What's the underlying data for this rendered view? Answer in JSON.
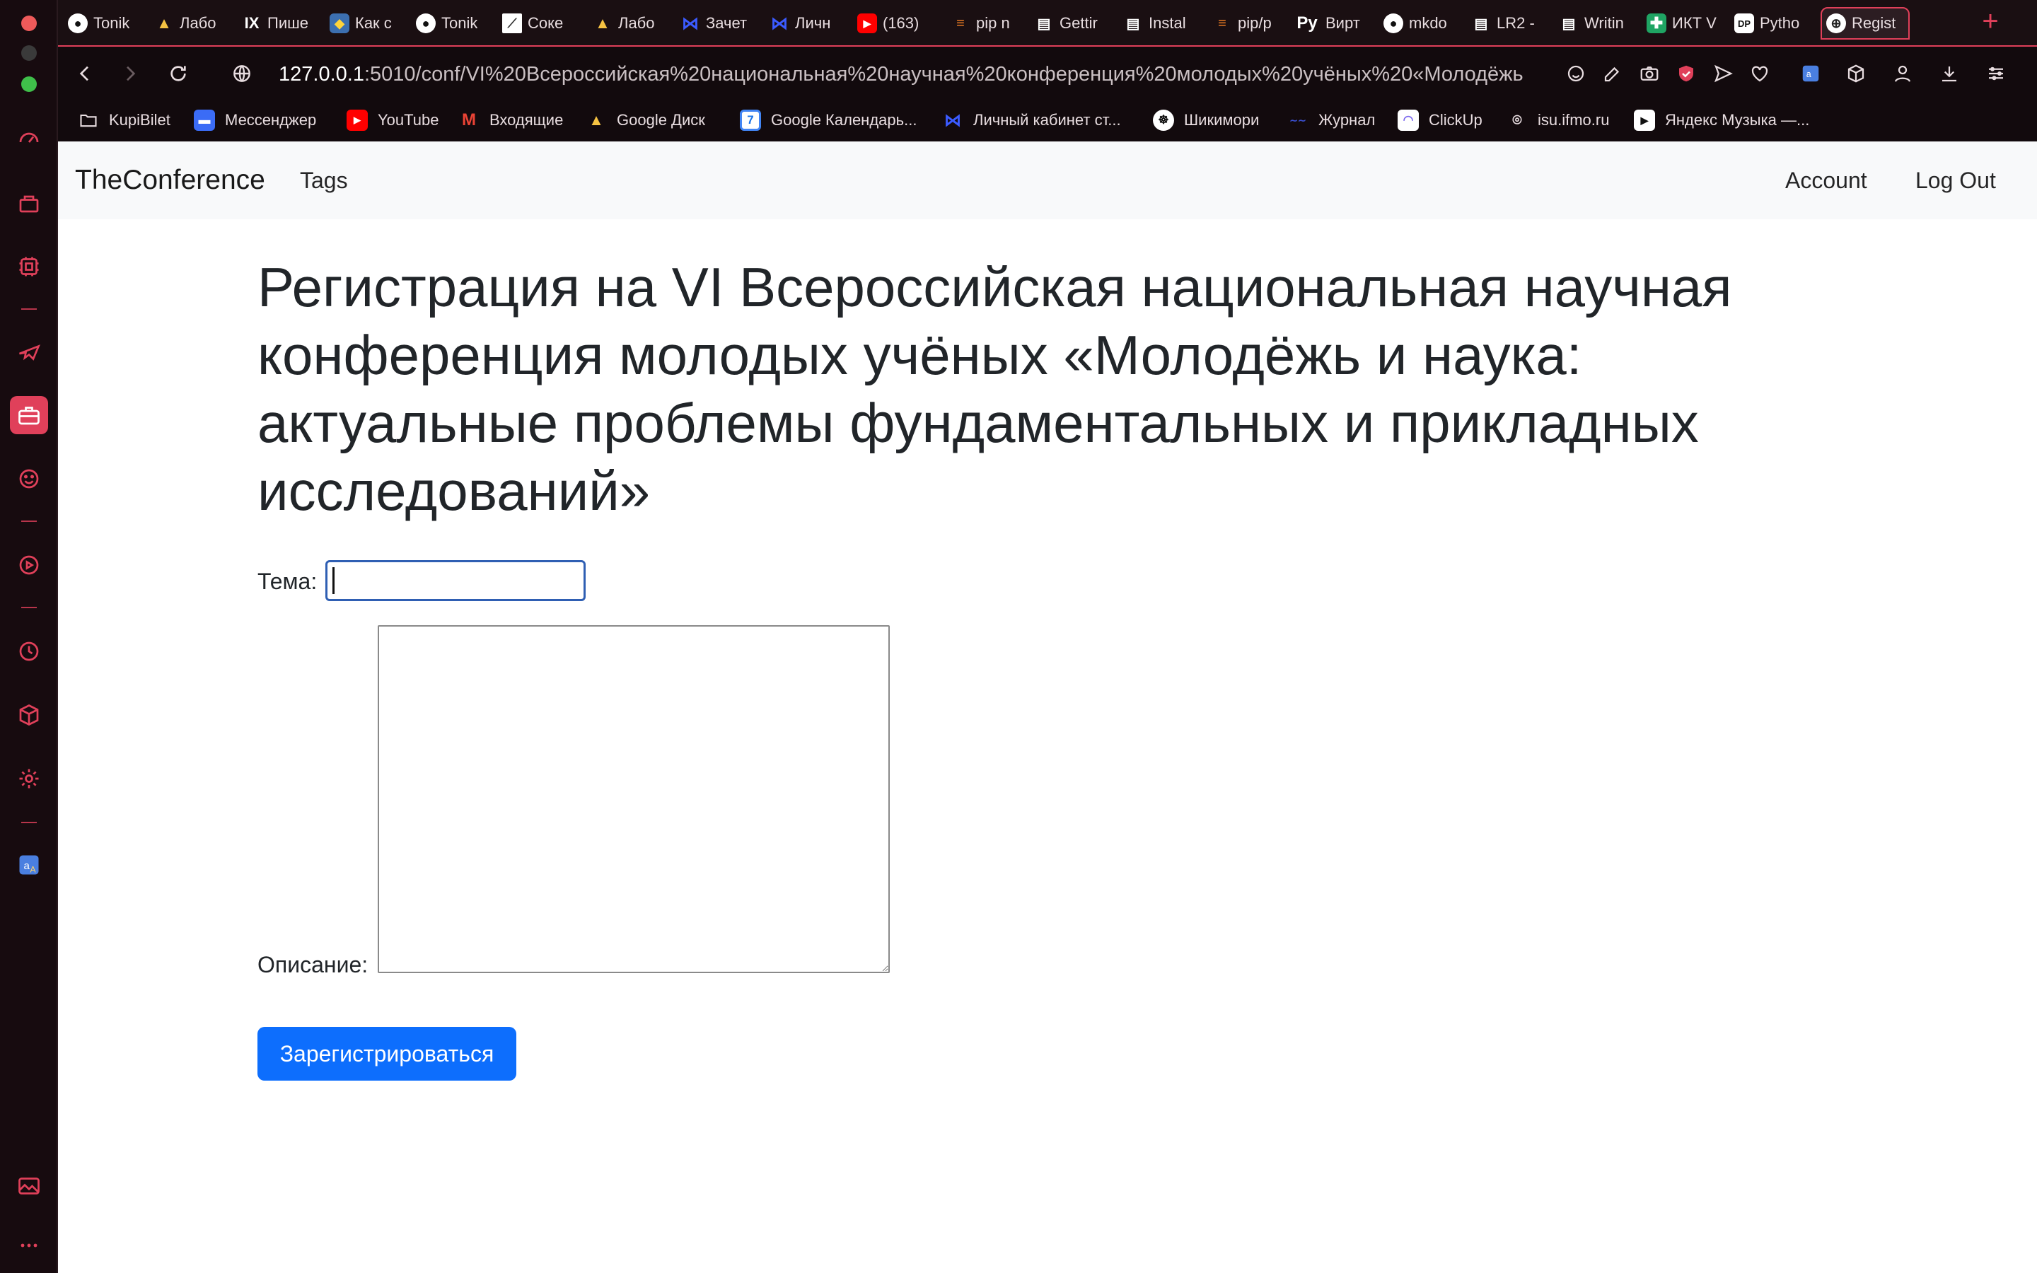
{
  "colors": {
    "accent": "#e0405a",
    "primary_button": "#0d6efd",
    "navbar_bg": "#f8f9fa",
    "chrome_bg": "#1a0f12"
  },
  "tabs": [
    {
      "title": "Tonik",
      "icon": "github-icon"
    },
    {
      "title": "Лабо",
      "icon": "google-drive-icon"
    },
    {
      "title": "Пише",
      "icon": "ix-icon"
    },
    {
      "title": "Как с",
      "icon": "python-icon"
    },
    {
      "title": "Tonik",
      "icon": "github-icon"
    },
    {
      "title": "Соке",
      "icon": "chart-icon"
    },
    {
      "title": "Лабо",
      "icon": "google-drive-icon"
    },
    {
      "title": "Зачет",
      "icon": "itmo-icon"
    },
    {
      "title": "Личн",
      "icon": "itmo-icon"
    },
    {
      "title": "(163)",
      "icon": "youtube-icon"
    },
    {
      "title": "pip n",
      "icon": "stackoverflow-icon"
    },
    {
      "title": "Gettir",
      "icon": "book-icon"
    },
    {
      "title": "Instal",
      "icon": "book-icon"
    },
    {
      "title": "pip/p",
      "icon": "stackoverflow-icon"
    },
    {
      "title": "Вирт",
      "icon": "py-icon",
      "prefix": "Py"
    },
    {
      "title": "mkdo",
      "icon": "github-icon"
    },
    {
      "title": "LR2 -",
      "icon": "book-icon"
    },
    {
      "title": "Writin",
      "icon": "book-icon"
    },
    {
      "title": "ИКТ V",
      "icon": "sheets-icon"
    },
    {
      "title": "Pytho",
      "icon": "dp-icon",
      "prefix": "DP"
    },
    {
      "title": "Regist",
      "icon": "globe-icon"
    }
  ],
  "address": {
    "host": "127.0.0.1",
    "rest": ":5010/conf/VI%20Всероссийская%20национальная%20научная%20конференция%20молодых%20учёных%20«Молодёжь"
  },
  "bookmarks": [
    {
      "label": "KupiBilet",
      "icon": "folder-icon"
    },
    {
      "label": "Мессенджер",
      "icon": "messenger-icon"
    },
    {
      "label": "YouTube",
      "icon": "youtube-icon"
    },
    {
      "label": "Входящие",
      "icon": "gmail-icon"
    },
    {
      "label": "Google Диск",
      "icon": "google-drive-icon"
    },
    {
      "label": "Google Календарь...",
      "icon": "calendar-icon",
      "badge": "7"
    },
    {
      "label": "Личный кабинет ст...",
      "icon": "itmo-icon"
    },
    {
      "label": "Шикимори",
      "icon": "shikimori-icon"
    },
    {
      "label": "Журнал",
      "icon": "journal-icon"
    },
    {
      "label": "ClickUp",
      "icon": "clickup-icon"
    },
    {
      "label": "isu.ifmo.ru",
      "icon": "isu-icon"
    },
    {
      "label": "Яндекс Музыка —...",
      "icon": "play-icon"
    }
  ],
  "navbar": {
    "brand": "TheConference",
    "tags": "Tags",
    "account": "Account",
    "logout": "Log Out"
  },
  "page": {
    "title": "Регистрация на VI Всероссийская национальная научная конференция молодых учёных «Молодёжь и наука: актуальные проблемы фундаментальных и прикладных исследований»"
  },
  "form": {
    "topic_label": "Тема:",
    "topic_value": "",
    "description_label": "Описание:",
    "description_value": "",
    "submit_label": "Зарегистрироваться"
  }
}
